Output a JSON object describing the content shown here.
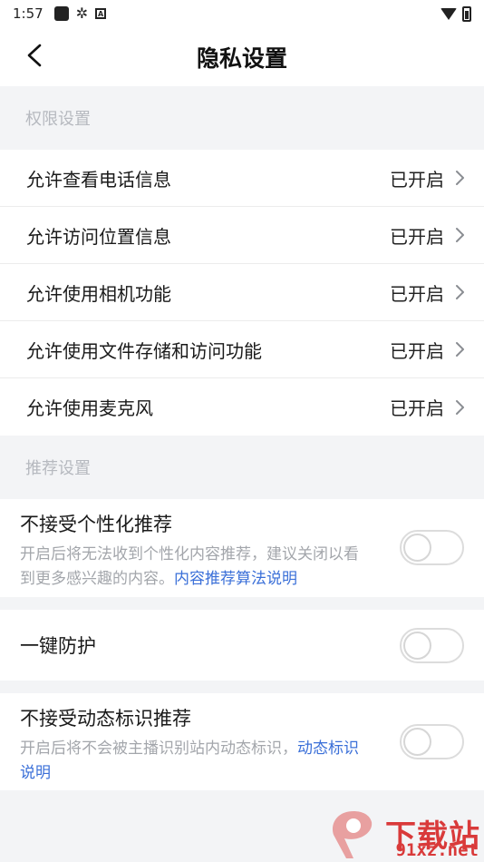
{
  "status_bar": {
    "time": "1:57",
    "a_label": "A"
  },
  "header": {
    "title": "隐私设置"
  },
  "permissions_section": {
    "label": "权限设置",
    "items": [
      {
        "label": "允许查看电话信息",
        "status": "已开启"
      },
      {
        "label": "允许访问位置信息",
        "status": "已开启"
      },
      {
        "label": "允许使用相机功能",
        "status": "已开启"
      },
      {
        "label": "允许使用文件存储和访问功能",
        "status": "已开启"
      },
      {
        "label": "允许使用麦克风",
        "status": "已开启"
      }
    ]
  },
  "recommend_section": {
    "label": "推荐设置",
    "personalized": {
      "title": "不接受个性化推荐",
      "desc": "开启后将无法收到个性化内容推荐，建议关闭以看到更多感兴趣的内容。",
      "link": "内容推荐算法说明",
      "enabled": false
    },
    "one_key": {
      "title": "一键防护",
      "enabled": false
    },
    "dynamic": {
      "title": "不接受动态标识推荐",
      "desc": "开启后将不会被主播识别站内动态标识，",
      "link": "动态标识说明",
      "enabled": false
    }
  },
  "watermark": {
    "line1": "下载站",
    "line2": "91xz.net"
  },
  "colors": {
    "link": "#3a6fd8",
    "section_label": "#b6b9bf",
    "background": "#f3f4f6",
    "watermark": "#d93a3a"
  }
}
